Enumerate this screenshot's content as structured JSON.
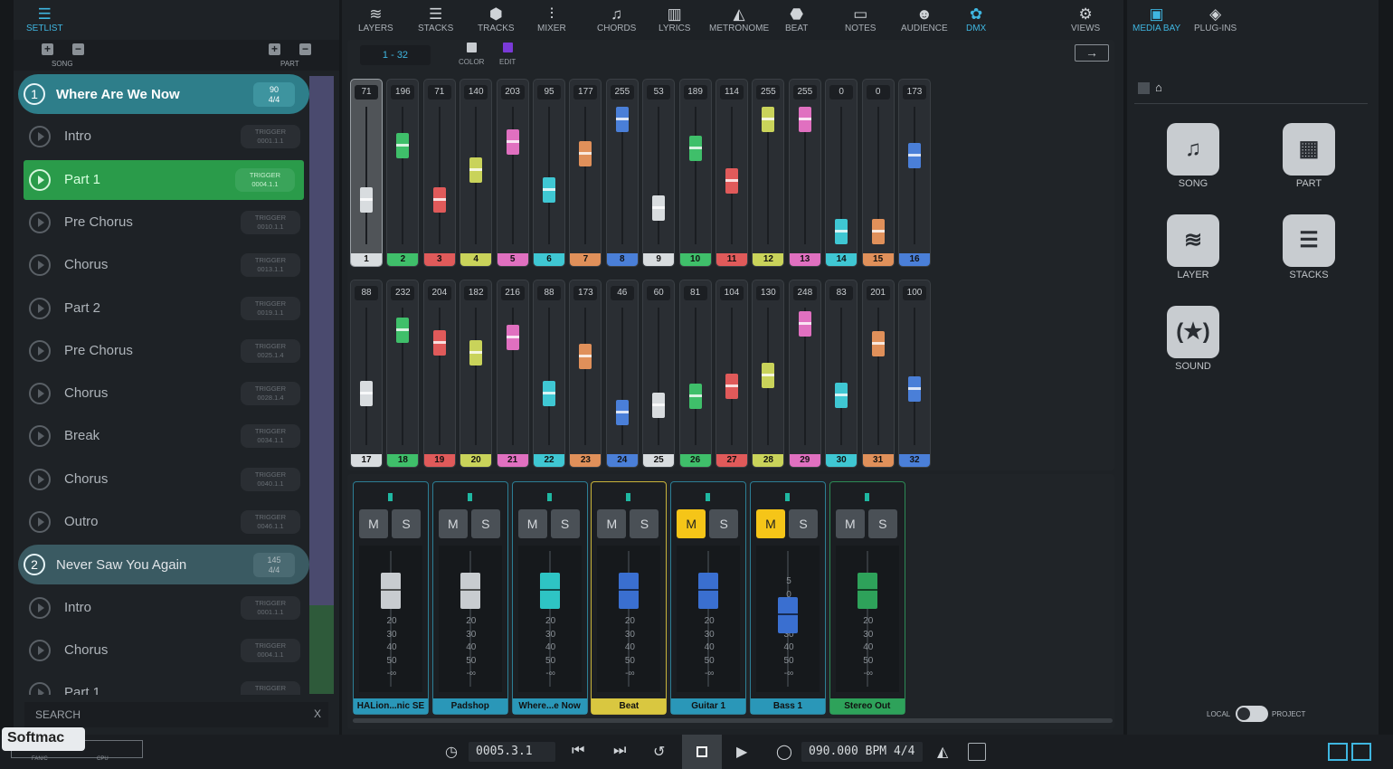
{
  "left": {
    "setlist_label": "SETLIST",
    "song_label": "SONG",
    "part_label": "PART",
    "search_placeholder": "SEARCH",
    "search_clear": "X"
  },
  "setlist": [
    {
      "kind": "song",
      "num": "1",
      "title": "Where Are We Now",
      "tempo": "90",
      "sig": "4/4"
    },
    {
      "kind": "part",
      "title": "Intro",
      "trigger": "0001.1.1"
    },
    {
      "kind": "part",
      "title": "Part 1",
      "trigger": "0004.1.1",
      "selected": true
    },
    {
      "kind": "part",
      "title": "Pre Chorus",
      "trigger": "0010.1.1"
    },
    {
      "kind": "part",
      "title": "Chorus",
      "trigger": "0013.1.1"
    },
    {
      "kind": "part",
      "title": "Part 2",
      "trigger": "0019.1.1"
    },
    {
      "kind": "part",
      "title": "Pre Chorus",
      "trigger": "0025.1.4"
    },
    {
      "kind": "part",
      "title": "Chorus",
      "trigger": "0028.1.4"
    },
    {
      "kind": "part",
      "title": "Break",
      "trigger": "0034.1.1"
    },
    {
      "kind": "part",
      "title": "Chorus",
      "trigger": "0040.1.1"
    },
    {
      "kind": "part",
      "title": "Outro",
      "trigger": "0046.1.1"
    },
    {
      "kind": "song",
      "num": "2",
      "title": "Never Saw You Again",
      "tempo": "145",
      "sig": "4/4"
    },
    {
      "kind": "part",
      "title": "Intro",
      "trigger": "0001.1.1"
    },
    {
      "kind": "part",
      "title": "Chorus",
      "trigger": "0004.1.1"
    },
    {
      "kind": "part",
      "title": "Part 1",
      "trigger": ""
    }
  ],
  "trigger_word": "TRIGGER",
  "topnav": [
    {
      "label": "LAYERS",
      "icon": "layers-icon",
      "glyph": "≋"
    },
    {
      "label": "STACKS",
      "icon": "stacks-icon",
      "glyph": "☰"
    },
    {
      "label": "TRACKS",
      "icon": "tracks-icon",
      "glyph": "⬢"
    },
    {
      "label": "MIXER",
      "icon": "mixer-icon",
      "glyph": "⫶"
    },
    {
      "label": "CHORDS",
      "icon": "chords-icon",
      "glyph": "♫"
    },
    {
      "label": "LYRICS",
      "icon": "lyrics-icon",
      "glyph": "▥"
    },
    {
      "label": "METRONOME",
      "icon": "metronome-icon",
      "glyph": "◭"
    },
    {
      "label": "BEAT",
      "icon": "beat-icon",
      "glyph": "⬣"
    },
    {
      "label": "NOTES",
      "icon": "notes-icon",
      "glyph": "▭"
    },
    {
      "label": "AUDIENCE",
      "icon": "audience-icon",
      "glyph": "☻"
    },
    {
      "label": "DMX",
      "icon": "dmx-icon",
      "glyph": "✿"
    },
    {
      "label": "VIEWS",
      "icon": "gear-icon",
      "glyph": "⚙"
    }
  ],
  "dmx": {
    "range": "1 - 32",
    "color_label": "COLOR",
    "edit_label": "EDIT",
    "channels": [
      {
        "n": "1",
        "v": "71",
        "c": "#d8dcdf",
        "level": 0.28
      },
      {
        "n": "2",
        "v": "196",
        "c": "#3fbf6a",
        "level": 0.77
      },
      {
        "n": "3",
        "v": "71",
        "c": "#e05a5a",
        "level": 0.28
      },
      {
        "n": "4",
        "v": "140",
        "c": "#c9d35a",
        "level": 0.55
      },
      {
        "n": "5",
        "v": "203",
        "c": "#e070c0",
        "level": 0.8
      },
      {
        "n": "6",
        "v": "95",
        "c": "#3fc7d3",
        "level": 0.37
      },
      {
        "n": "7",
        "v": "177",
        "c": "#e0905a",
        "level": 0.69
      },
      {
        "n": "8",
        "v": "255",
        "c": "#4a7fd8",
        "level": 1.0
      },
      {
        "n": "9",
        "v": "53",
        "c": "#d8dcdf",
        "level": 0.21
      },
      {
        "n": "10",
        "v": "189",
        "c": "#3fbf6a",
        "level": 0.74
      },
      {
        "n": "11",
        "v": "114",
        "c": "#e05a5a",
        "level": 0.45
      },
      {
        "n": "12",
        "v": "255",
        "c": "#c9d35a",
        "level": 1.0
      },
      {
        "n": "13",
        "v": "255",
        "c": "#e070c0",
        "level": 1.0
      },
      {
        "n": "14",
        "v": "0",
        "c": "#3fc7d3",
        "level": 0.0
      },
      {
        "n": "15",
        "v": "0",
        "c": "#e0905a",
        "level": 0.0
      },
      {
        "n": "16",
        "v": "173",
        "c": "#4a7fd8",
        "level": 0.68
      },
      {
        "n": "17",
        "v": "88",
        "c": "#d8dcdf",
        "level": 0.35
      },
      {
        "n": "18",
        "v": "232",
        "c": "#3fbf6a",
        "level": 0.91
      },
      {
        "n": "19",
        "v": "204",
        "c": "#e05a5a",
        "level": 0.8
      },
      {
        "n": "20",
        "v": "182",
        "c": "#c9d35a",
        "level": 0.71
      },
      {
        "n": "21",
        "v": "216",
        "c": "#e070c0",
        "level": 0.85
      },
      {
        "n": "22",
        "v": "88",
        "c": "#3fc7d3",
        "level": 0.35
      },
      {
        "n": "23",
        "v": "173",
        "c": "#e0905a",
        "level": 0.68
      },
      {
        "n": "24",
        "v": "46",
        "c": "#4a7fd8",
        "level": 0.18
      },
      {
        "n": "25",
        "v": "60",
        "c": "#d8dcdf",
        "level": 0.24
      },
      {
        "n": "26",
        "v": "81",
        "c": "#3fbf6a",
        "level": 0.32
      },
      {
        "n": "27",
        "v": "104",
        "c": "#e05a5a",
        "level": 0.41
      },
      {
        "n": "28",
        "v": "130",
        "c": "#c9d35a",
        "level": 0.51
      },
      {
        "n": "29",
        "v": "248",
        "c": "#e070c0",
        "level": 0.97
      },
      {
        "n": "30",
        "v": "83",
        "c": "#3fc7d3",
        "level": 0.33
      },
      {
        "n": "31",
        "v": "201",
        "c": "#e0905a",
        "level": 0.79
      },
      {
        "n": "32",
        "v": "100",
        "c": "#4a7fd8",
        "level": 0.39
      }
    ]
  },
  "mixer": {
    "mute": "M",
    "solo": "S",
    "scale": [
      "20",
      "30",
      "40",
      "50",
      "-∞"
    ],
    "bass_extra": [
      "5",
      "0"
    ],
    "strips": [
      {
        "name": "HALion...nic SE",
        "color": "#c8ccd0",
        "mute": false,
        "sel": false
      },
      {
        "name": "Padshop",
        "color": "#c8ccd0",
        "mute": false,
        "sel": false
      },
      {
        "name": "Where...e Now",
        "color": "#2ec4c4",
        "mute": false,
        "sel": false
      },
      {
        "name": "Beat",
        "color": "#3a6fd0",
        "mute": false,
        "sel": true
      },
      {
        "name": "Guitar 1",
        "color": "#3a6fd0",
        "mute": true,
        "sel": false
      },
      {
        "name": "Bass 1",
        "color": "#3a6fd0",
        "mute": true,
        "sel": false
      },
      {
        "name": "Stereo Out",
        "color": "#2ea25a",
        "mute": false,
        "sel": false,
        "master": true
      }
    ]
  },
  "transport": {
    "position": "0005.3.1",
    "tempo": "090.000",
    "bpm": "BPM",
    "sig": "4/4"
  },
  "right": {
    "media_bay": "MEDIA BAY",
    "plugins": "PLUG-INS",
    "tiles": [
      "SONG",
      "PART",
      "LAYER",
      "STACKS",
      "SOUND"
    ],
    "local": "LOCAL",
    "project": "PROJECT"
  },
  "watermark": {
    "brand": "Softmac",
    "tag1": "FAN/C",
    "tag2": "CPU"
  }
}
